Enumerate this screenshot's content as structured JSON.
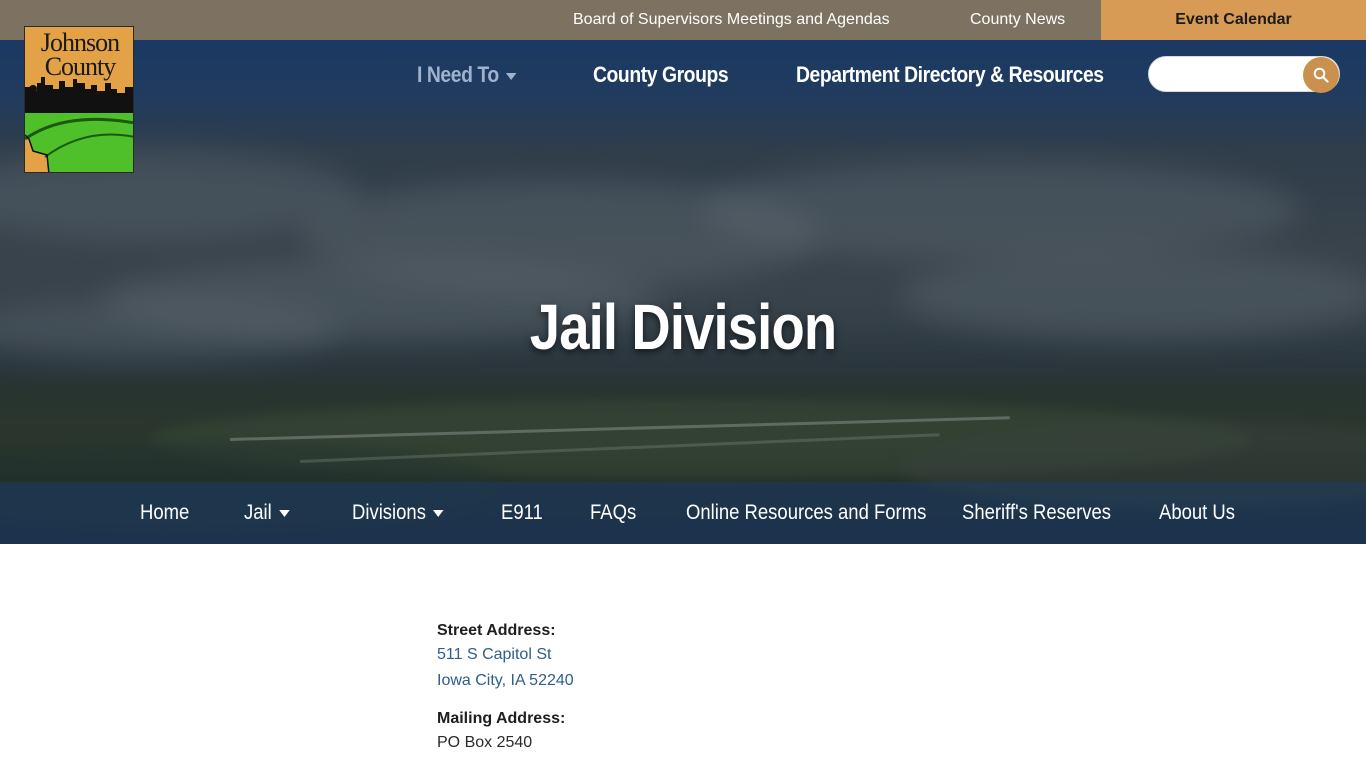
{
  "utility": {
    "board_label": "Board of Supervisors Meetings and Agendas",
    "news_label": "County News",
    "calendar_label": "Event Calendar"
  },
  "logo": {
    "line1": "Johnson",
    "line2": "County"
  },
  "main_nav": {
    "need_label": "I Need To",
    "groups_label": "County Groups",
    "dept_label": "Department Directory & Resources"
  },
  "search": {
    "placeholder": "",
    "icon": "search-icon"
  },
  "hero": {
    "title": "Jail Division"
  },
  "sub_nav": {
    "items": [
      {
        "label": "Home"
      },
      {
        "label": "Jail"
      },
      {
        "label": "Divisions"
      },
      {
        "label": "E911"
      },
      {
        "label": "FAQs"
      },
      {
        "label": "Online Resources and Forms"
      },
      {
        "label": "Sheriff's Reserves"
      },
      {
        "label": "About Us"
      }
    ]
  },
  "content": {
    "street_label": "Street Address:",
    "street_line1": "511 S Capitol St",
    "street_line2": "Iowa City, IA 52240",
    "mailing_label": "Mailing Address:",
    "mailing_line1": "PO Box 2540"
  },
  "colors": {
    "utility_bar": "#7d7261",
    "calendar_accent": "#d89b55",
    "search_button": "#c9904e",
    "link_blue": "#2f5d8c"
  }
}
